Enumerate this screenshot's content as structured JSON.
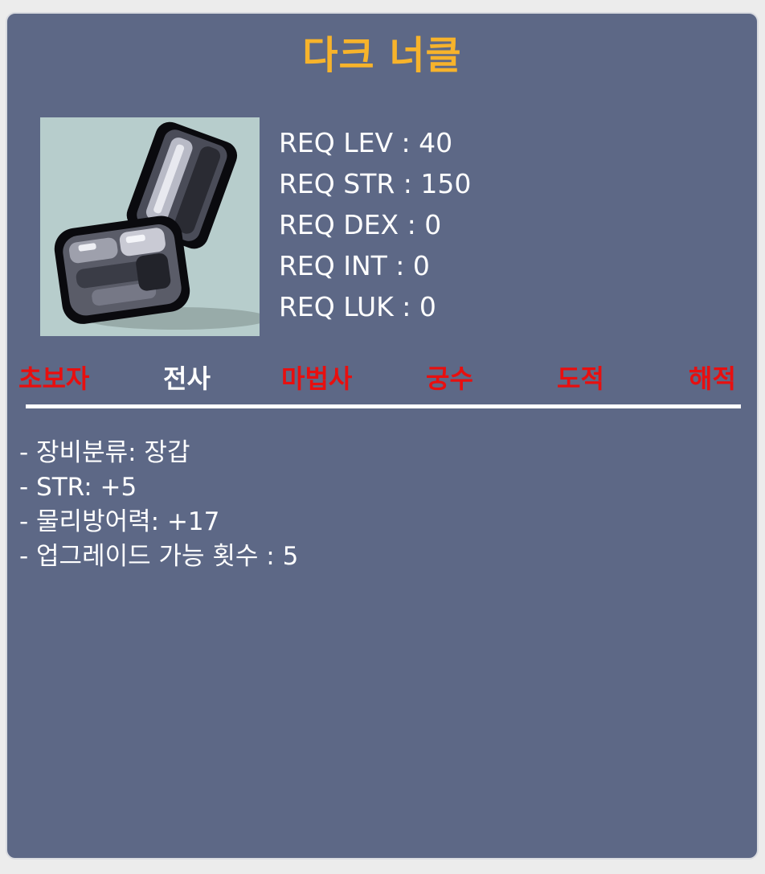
{
  "item": {
    "name": "다크 너클",
    "icon": "dark-knuckle-glove-icon"
  },
  "requirements": [
    "REQ LEV : 40",
    "REQ STR : 150",
    "REQ DEX : 0",
    "REQ INT : 0",
    "REQ LUK : 0"
  ],
  "jobs": [
    {
      "label": "초보자",
      "allowed": false
    },
    {
      "label": "전사",
      "allowed": true
    },
    {
      "label": "마법사",
      "allowed": false
    },
    {
      "label": "궁수",
      "allowed": false
    },
    {
      "label": "도적",
      "allowed": false
    },
    {
      "label": "해적",
      "allowed": false
    }
  ],
  "stats": [
    "- 장비분류: 장갑",
    "- STR: +5",
    "- 물리방어력: +17",
    "- 업그레이드 가능 횟수 : 5"
  ],
  "colors": {
    "panel": "#5d6886",
    "title": "#f7b32b",
    "job_disallowed": "#e80f0f",
    "job_allowed": "#ffffff",
    "icon_background": "#b7cdcc"
  }
}
